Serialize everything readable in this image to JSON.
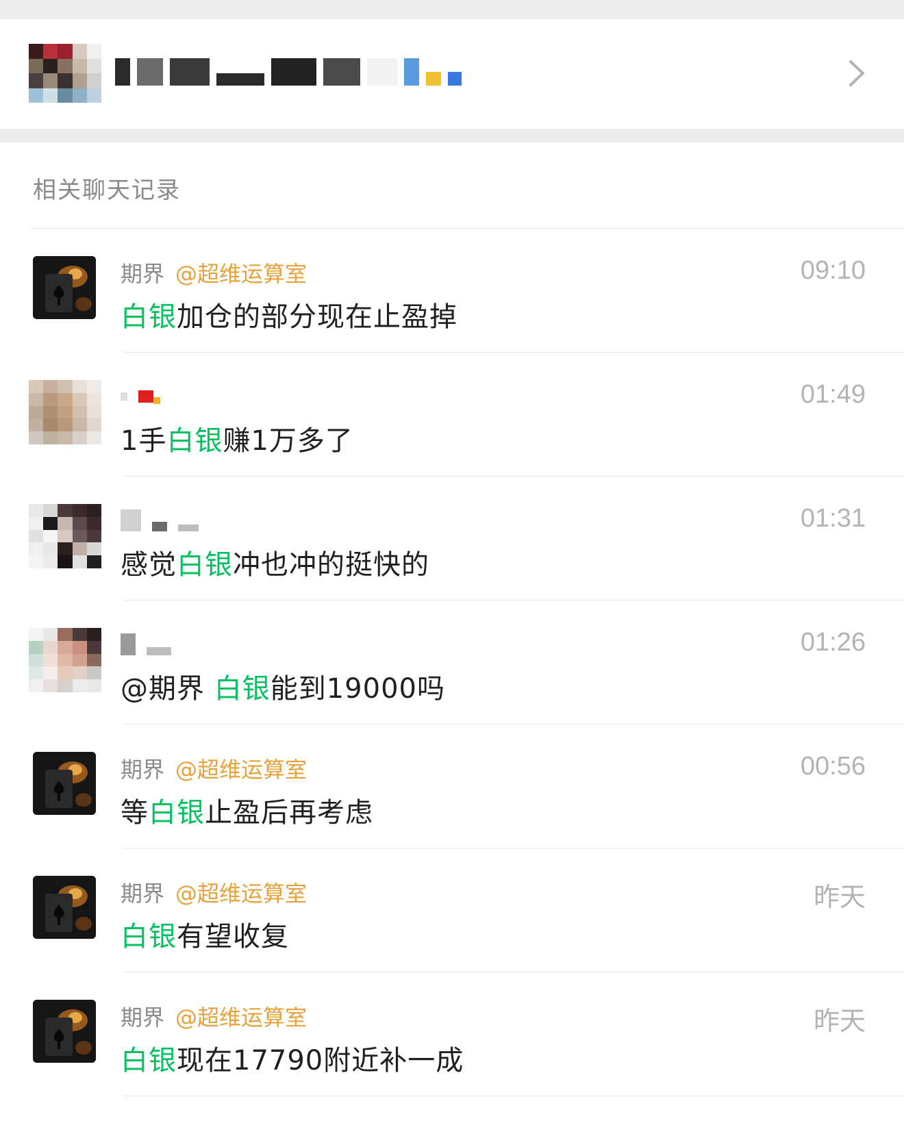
{
  "section_title": "相关聊天记录",
  "results": [
    {
      "avatar": "dark-card-avatar",
      "sender": "期界",
      "mention": "@超维运算室",
      "time": "09:10",
      "message": {
        "before": "",
        "highlight": "白银",
        "after": "加仓的部分现在止盈掉"
      }
    },
    {
      "avatar": "mosaic-avatar",
      "sender": "",
      "mention": "",
      "time": "01:49",
      "message": {
        "before": "1手",
        "highlight": "白银",
        "after": "赚1万多了"
      }
    },
    {
      "avatar": "mosaic-avatar",
      "sender": "",
      "mention": "",
      "time": "01:31",
      "message": {
        "before": "感觉",
        "highlight": "白银",
        "after": "冲也冲的挺快的"
      }
    },
    {
      "avatar": "mosaic-avatar",
      "sender": "",
      "mention": "",
      "time": "01:26",
      "message": {
        "before": "@期界 ",
        "highlight": "白银",
        "after": "能到19000吗"
      }
    },
    {
      "avatar": "dark-card-avatar",
      "sender": "期界",
      "mention": "@超维运算室",
      "time": "00:56",
      "message": {
        "before": "等",
        "highlight": "白银",
        "after": "止盈后再考虑"
      }
    },
    {
      "avatar": "dark-card-avatar",
      "sender": "期界",
      "mention": "@超维运算室",
      "time": "昨天",
      "message": {
        "before": "",
        "highlight": "白银",
        "after": "有望收复"
      }
    },
    {
      "avatar": "dark-card-avatar",
      "sender": "期界",
      "mention": "@超维运算室",
      "time": "昨天",
      "message": {
        "before": "",
        "highlight": "白银",
        "after": "现在17790附近补一成"
      }
    }
  ],
  "colors": {
    "highlight": "#07c160",
    "mention": "#e6a23c",
    "muted": "#8a8a8a",
    "time": "#b3b3b3"
  },
  "icons": {
    "group_chevron": "chevron-right-icon"
  }
}
